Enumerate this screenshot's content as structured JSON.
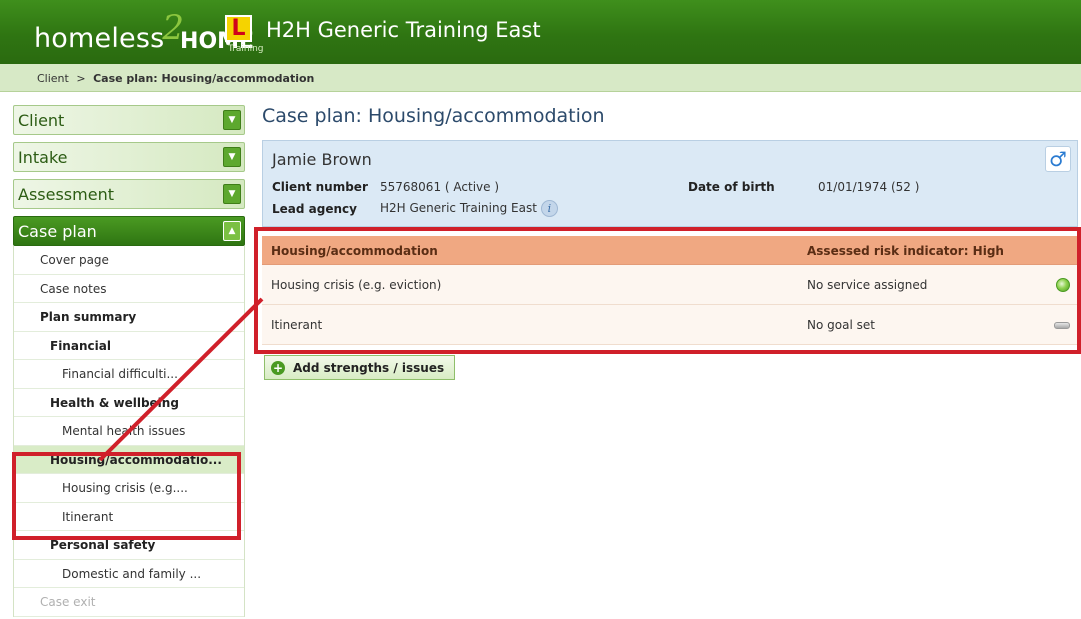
{
  "header": {
    "logo_homeless": "homeless",
    "logo_two": "2",
    "logo_home": "HOME",
    "plate_letter": "L",
    "training_label": "Training",
    "app_title": "H2H Generic Training East"
  },
  "breadcrumb": {
    "items": [
      "Client",
      "Case plan: Housing/accommodation"
    ],
    "separator": ">"
  },
  "sidebar": {
    "sections": [
      {
        "label": "Client",
        "icon": "chevron-down-icon"
      },
      {
        "label": "Intake",
        "icon": "chevron-down-icon"
      },
      {
        "label": "Assessment",
        "icon": "chevron-down-icon"
      },
      {
        "label": "Case plan",
        "icon": "chevron-up-icon"
      }
    ],
    "case_plan_items": [
      "Cover page",
      "Case notes",
      "Plan summary",
      "Financial",
      "Financial difficulti...",
      "Health & wellbeing",
      "Mental health issues",
      "Housing/accommodatio...",
      "Housing crisis (e.g....",
      "Itinerant",
      "Personal safety",
      "Domestic and family ...",
      "Case exit"
    ]
  },
  "main": {
    "title": "Case plan: Housing/accommodation",
    "client": {
      "name": "Jamie Brown",
      "gender_icon": "male-icon",
      "client_number_label": "Client number",
      "client_number_value": "55768061 ( Active )",
      "lead_agency_label": "Lead agency",
      "lead_agency_value": "H2H Generic Training East",
      "dob_label": "Date of birth",
      "dob_value": "01/01/1974 (52 )",
      "info_icon_glyph": "i"
    },
    "plan_table": {
      "header_left": "Housing/accommodation",
      "header_right": "Assessed risk indicator: High",
      "rows": [
        {
          "issue": "Housing crisis (e.g. eviction)",
          "status": "No service assigned",
          "status_icon": "green-circle-icon"
        },
        {
          "issue": "Itinerant",
          "status": "No goal set",
          "status_icon": "grey-bar-icon"
        }
      ]
    },
    "add_button_label": "Add strengths / issues",
    "add_button_glyph": "+"
  },
  "colors": {
    "header_green": "#2f7512",
    "breadcrumb_bg": "#d7e9c6",
    "client_panel_bg": "#dbe9f5",
    "plan_header_bg": "#f0a882",
    "highlight_red": "#d0202a"
  }
}
